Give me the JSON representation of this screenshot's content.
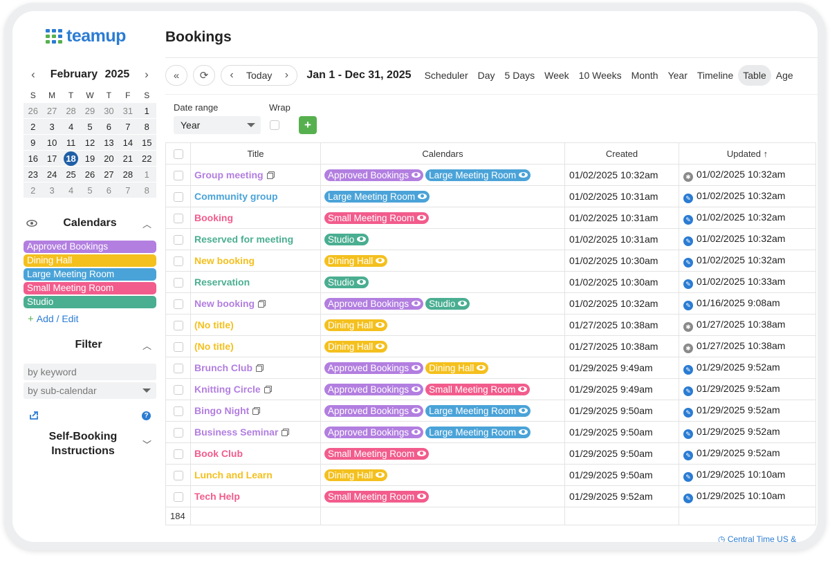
{
  "app": {
    "logo_text": "teamup",
    "page_title": "Bookings",
    "colors": {
      "brand": "#2b7cd3",
      "accent_green": "#56b04e"
    }
  },
  "mini_calendar": {
    "month": "February",
    "year": "2025",
    "weekdays": [
      "S",
      "M",
      "T",
      "W",
      "T",
      "F",
      "S"
    ],
    "weeks": [
      [
        "26",
        "27",
        "28",
        "29",
        "30",
        "31",
        "1"
      ],
      [
        "2",
        "3",
        "4",
        "5",
        "6",
        "7",
        "8"
      ],
      [
        "9",
        "10",
        "11",
        "12",
        "13",
        "14",
        "15"
      ],
      [
        "16",
        "17",
        "18",
        "19",
        "20",
        "21",
        "22"
      ],
      [
        "23",
        "24",
        "25",
        "26",
        "27",
        "28",
        "1"
      ],
      [
        "2",
        "3",
        "4",
        "5",
        "6",
        "7",
        "8"
      ]
    ],
    "today": "18"
  },
  "sidebar": {
    "calendars_title": "Calendars",
    "calendars": [
      {
        "name": "Approved Bookings",
        "color": "#b27ee0"
      },
      {
        "name": "Dining Hall",
        "color": "#f4c01e"
      },
      {
        "name": "Large Meeting Room",
        "color": "#4aa3d8"
      },
      {
        "name": "Small Meeting Room",
        "color": "#f25c8c"
      },
      {
        "name": "Studio",
        "color": "#4aae91"
      }
    ],
    "add_edit_label": "Add / Edit",
    "filter_title": "Filter",
    "keyword_placeholder": "by keyword",
    "subcal_placeholder": "by sub-calendar",
    "self_booking_line1": "Self-Booking",
    "self_booking_line2": "Instructions"
  },
  "toolbar": {
    "today_label": "Today",
    "date_range": "Jan 1 - Dec 31, 2025",
    "views": [
      "Scheduler",
      "Day",
      "5 Days",
      "Week",
      "10 Weeks",
      "Month",
      "Year",
      "Timeline",
      "Table",
      "Age"
    ],
    "active_view": "Table"
  },
  "controls": {
    "date_range_label": "Date range",
    "date_range_value": "Year",
    "wrap_label": "Wrap"
  },
  "table": {
    "headers": {
      "title": "Title",
      "calendars": "Calendars",
      "created": "Created",
      "updated": "Updated ↑"
    },
    "rows": [
      {
        "title": "Group meeting",
        "color": "#b27ee0",
        "dup": true,
        "cals": [
          "Approved Bookings",
          "Large Meeting Room"
        ],
        "created": "01/02/2025 10:32am",
        "updated": "01/02/2025 10:32am",
        "icon": "new"
      },
      {
        "title": "Community group",
        "color": "#4aa3d8",
        "dup": false,
        "cals": [
          "Large Meeting Room"
        ],
        "created": "01/02/2025 10:31am",
        "updated": "01/02/2025 10:32am",
        "icon": "edit"
      },
      {
        "title": "Booking",
        "color": "#f25c8c",
        "dup": false,
        "cals": [
          "Small Meeting Room"
        ],
        "created": "01/02/2025 10:31am",
        "updated": "01/02/2025 10:32am",
        "icon": "edit"
      },
      {
        "title": "Reserved for meeting",
        "color": "#4aae91",
        "dup": false,
        "cals": [
          "Studio"
        ],
        "created": "01/02/2025 10:31am",
        "updated": "01/02/2025 10:32am",
        "icon": "edit"
      },
      {
        "title": "New booking",
        "color": "#f4c01e",
        "dup": false,
        "cals": [
          "Dining Hall"
        ],
        "created": "01/02/2025 10:30am",
        "updated": "01/02/2025 10:32am",
        "icon": "edit"
      },
      {
        "title": "Reservation",
        "color": "#4aae91",
        "dup": false,
        "cals": [
          "Studio"
        ],
        "created": "01/02/2025 10:30am",
        "updated": "01/02/2025 10:33am",
        "icon": "edit"
      },
      {
        "title": "New booking",
        "color": "#b27ee0",
        "dup": true,
        "cals": [
          "Approved Bookings",
          "Studio"
        ],
        "created": "01/02/2025 10:32am",
        "updated": "01/16/2025 9:08am",
        "icon": "edit"
      },
      {
        "title": "(No title)",
        "color": "#f4c01e",
        "dup": false,
        "cals": [
          "Dining Hall"
        ],
        "created": "01/27/2025 10:38am",
        "updated": "01/27/2025 10:38am",
        "icon": "new"
      },
      {
        "title": "(No title)",
        "color": "#f4c01e",
        "dup": false,
        "cals": [
          "Dining Hall"
        ],
        "created": "01/27/2025 10:38am",
        "updated": "01/27/2025 10:38am",
        "icon": "new"
      },
      {
        "title": "Brunch Club",
        "color": "#b27ee0",
        "dup": true,
        "cals": [
          "Approved Bookings",
          "Dining Hall"
        ],
        "created": "01/29/2025 9:49am",
        "updated": "01/29/2025 9:52am",
        "icon": "edit"
      },
      {
        "title": "Knitting Circle",
        "color": "#b27ee0",
        "dup": true,
        "cals": [
          "Approved Bookings",
          "Small Meeting Room"
        ],
        "created": "01/29/2025 9:49am",
        "updated": "01/29/2025 9:52am",
        "icon": "edit"
      },
      {
        "title": "Bingo Night",
        "color": "#b27ee0",
        "dup": true,
        "cals": [
          "Approved Bookings",
          "Large Meeting Room"
        ],
        "created": "01/29/2025 9:50am",
        "updated": "01/29/2025 9:52am",
        "icon": "edit"
      },
      {
        "title": "Business Seminar",
        "color": "#b27ee0",
        "dup": true,
        "cals": [
          "Approved Bookings",
          "Large Meeting Room"
        ],
        "created": "01/29/2025 9:50am",
        "updated": "01/29/2025 9:52am",
        "icon": "edit"
      },
      {
        "title": "Book Club",
        "color": "#f25c8c",
        "dup": false,
        "cals": [
          "Small Meeting Room"
        ],
        "created": "01/29/2025 9:50am",
        "updated": "01/29/2025 9:52am",
        "icon": "edit"
      },
      {
        "title": "Lunch and Learn",
        "color": "#f4c01e",
        "dup": false,
        "cals": [
          "Dining Hall"
        ],
        "created": "01/29/2025 9:50am",
        "updated": "01/29/2025 10:10am",
        "icon": "edit"
      },
      {
        "title": "Tech Help",
        "color": "#f25c8c",
        "dup": false,
        "cals": [
          "Small Meeting Room"
        ],
        "created": "01/29/2025 9:52am",
        "updated": "01/29/2025 10:10am",
        "icon": "edit"
      }
    ],
    "count": "184"
  },
  "timezone_label": "Central Time US &"
}
